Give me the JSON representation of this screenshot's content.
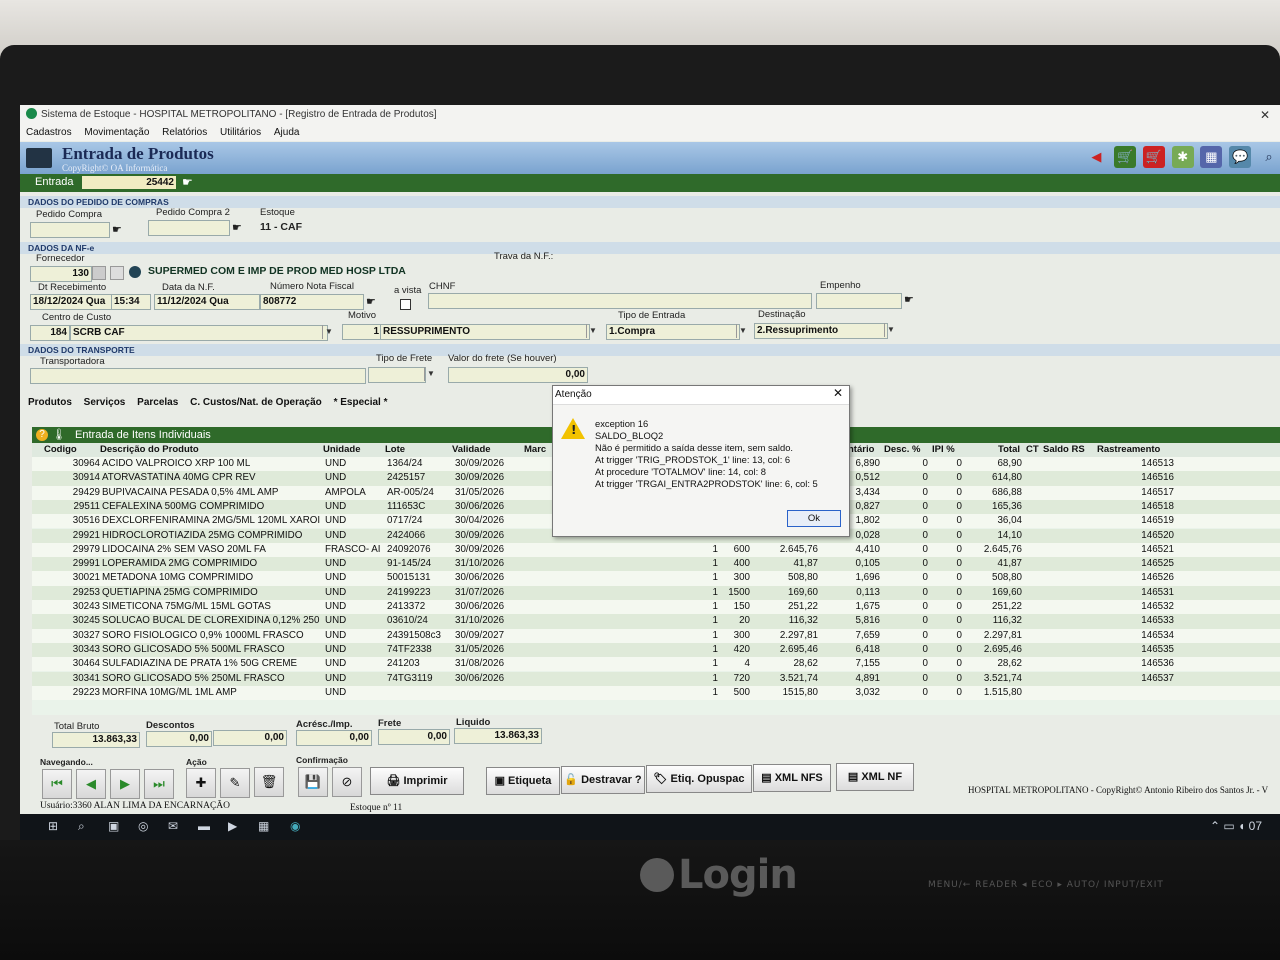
{
  "window": {
    "title": "Sistema de Estoque - HOSPITAL METROPOLITANO - [Registro de Entrada de Produtos]"
  },
  "menu": [
    "Cadastros",
    "Movimentação",
    "Relatórios",
    "Utilitários",
    "Ajuda"
  ],
  "header": {
    "title": "Entrada de Produtos",
    "copyright": "CopyRight© OA Informática"
  },
  "entrada": {
    "label": "Entrada",
    "value": "25442"
  },
  "pedido": {
    "section": "DADOS DO PEDIDO DE COMPRAS",
    "pedido_compra_label": "Pedido Compra",
    "pedido_compra2_label": "Pedido Compra 2",
    "estoque_label": "Estoque",
    "estoque_value": "11 - CAF"
  },
  "nfe": {
    "section": "DADOS DA NF-e",
    "fornecedor_label": "Fornecedor",
    "fornecedor_code": "130",
    "fornecedor_name": "SUPERMED COM E IMP DE PROD MED HOSP LTDA",
    "trava_label": "Trava da N.F.:",
    "dt_receb_label": "Dt Recebimento",
    "dt_receb_date": "18/12/2024 Qua",
    "dt_receb_time": "15:34",
    "data_nf_label": "Data da N.F.",
    "data_nf_value": "11/12/2024 Qua",
    "numero_label": "Número Nota Fiscal",
    "numero_value": "808772",
    "avista_label": "a vista",
    "chnf_label": "CHNF",
    "empenho_label": "Empenho",
    "cc_label": "Centro de Custo",
    "cc_code": "184",
    "cc_name": "SCRB CAF",
    "motivo_label": "Motivo",
    "motivo_code": "1",
    "motivo_name": "RESSUPRIMENTO",
    "tipo_label": "Tipo de Entrada",
    "tipo_value": "1.Compra",
    "dest_label": "Destinação",
    "dest_value": "2.Ressuprimento"
  },
  "transporte": {
    "section": "DADOS DO TRANSPORTE",
    "transportadora_label": "Transportadora",
    "frete_label": "Tipo de Frete",
    "valor_label": "Valor do frete (Se houver)",
    "valor_value": "0,00"
  },
  "tabs": [
    "Produtos",
    "Serviços",
    "Parcelas",
    "C. Custos/Nat. de Operação",
    "* Especial *"
  ],
  "grid": {
    "title": "Entrada de Itens Individuais",
    "headers": [
      "Codigo",
      "Descrição do Produto",
      "Unidade",
      "Lote",
      "Validade",
      "Marc",
      "ntário",
      "Desc. %",
      "IPI %",
      "Total",
      "CT",
      "Saldo RS",
      "Rastreamento"
    ],
    "rows": [
      {
        "cod": "30964",
        "desc": "ACIDO VALPROICO XRP 100 ML",
        "un": "UND",
        "lote": "1364/24",
        "val": "30/09/2026",
        "qt": "",
        "qty": "",
        "unit": "6,890",
        "d": "0",
        "i": "0",
        "tot": "68,90",
        "r": "146513"
      },
      {
        "cod": "30914",
        "desc": "ATORVASTATINA 40MG CPR REV",
        "un": "UND",
        "lote": "2425157",
        "val": "30/09/2026",
        "qt": "",
        "qty": "",
        "unit": "0,512",
        "d": "0",
        "i": "0",
        "tot": "614,80",
        "r": "146516"
      },
      {
        "cod": "29429",
        "desc": "BUPIVACAINA PESADA 0,5% 4ML AMP",
        "un": "AMPOLA",
        "lote": "AR-005/24",
        "val": "31/05/2026",
        "qt": "",
        "qty": "",
        "unit": "3,434",
        "d": "0",
        "i": "0",
        "tot": "686,88",
        "r": "146517"
      },
      {
        "cod": "29511",
        "desc": "CEFALEXINA 500MG COMPRIMIDO",
        "un": "UND",
        "lote": "111653C",
        "val": "30/06/2026",
        "qt": "",
        "qty": "",
        "unit": "0,827",
        "d": "0",
        "i": "0",
        "tot": "165,36",
        "r": "146518"
      },
      {
        "cod": "30516",
        "desc": "DEXCLORFENIRAMINA 2MG/5ML 120ML XAROI",
        "un": "UND",
        "lote": "0717/24",
        "val": "30/04/2026",
        "qt": "",
        "qty": "",
        "unit": "1,802",
        "d": "0",
        "i": "0",
        "tot": "36,04",
        "r": "146519"
      },
      {
        "cod": "29921",
        "desc": "HIDROCLOROTIAZIDA 25MG COMPRIMIDO",
        "un": "UND",
        "lote": "2424066",
        "val": "30/09/2026",
        "qt": "",
        "qty": "",
        "unit": "0,028",
        "d": "0",
        "i": "0",
        "tot": "14,10",
        "r": "146520"
      },
      {
        "cod": "29979",
        "desc": "LIDOCAINA 2% SEM VASO 20ML FA",
        "un": "FRASCO- AI",
        "lote": "24092076",
        "val": "30/09/2026",
        "qt": "1",
        "qty": "600",
        "sub": "2.645,76",
        "unit": "4,410",
        "d": "0",
        "i": "0",
        "tot": "2.645,76",
        "r": "146521"
      },
      {
        "cod": "29991",
        "desc": "LOPERAMIDA 2MG COMPRIMIDO",
        "un": "UND",
        "lote": "91-145/24",
        "val": "31/10/2026",
        "qt": "1",
        "qty": "400",
        "sub": "41,87",
        "unit": "0,105",
        "d": "0",
        "i": "0",
        "tot": "41,87",
        "r": "146525"
      },
      {
        "cod": "30021",
        "desc": "METADONA 10MG COMPRIMIDO",
        "un": "UND",
        "lote": "50015131",
        "val": "30/06/2026",
        "qt": "1",
        "qty": "300",
        "sub": "508,80",
        "unit": "1,696",
        "d": "0",
        "i": "0",
        "tot": "508,80",
        "r": "146526"
      },
      {
        "cod": "29253",
        "desc": "QUETIAPINA 25MG COMPRIMIDO",
        "un": "UND",
        "lote": "24199223",
        "val": "31/07/2026",
        "qt": "1",
        "qty": "1500",
        "sub": "169,60",
        "unit": "0,113",
        "d": "0",
        "i": "0",
        "tot": "169,60",
        "r": "146531"
      },
      {
        "cod": "30243",
        "desc": "SIMETICONA 75MG/ML 15ML GOTAS",
        "un": "UND",
        "lote": "2413372",
        "val": "30/06/2026",
        "qt": "1",
        "qty": "150",
        "sub": "251,22",
        "unit": "1,675",
        "d": "0",
        "i": "0",
        "tot": "251,22",
        "r": "146532"
      },
      {
        "cod": "30245",
        "desc": "SOLUCAO BUCAL DE CLOREXIDINA 0,12% 250",
        "un": "UND",
        "lote": "03610/24",
        "val": "31/10/2026",
        "qt": "1",
        "qty": "20",
        "sub": "116,32",
        "unit": "5,816",
        "d": "0",
        "i": "0",
        "tot": "116,32",
        "r": "146533"
      },
      {
        "cod": "30327",
        "desc": "SORO FISIOLOGICO 0,9% 1000ML FRASCO",
        "un": "UND",
        "lote": "24391508c3",
        "val": "30/09/2027",
        "qt": "1",
        "qty": "300",
        "sub": "2.297,81",
        "unit": "7,659",
        "d": "0",
        "i": "0",
        "tot": "2.297,81",
        "r": "146534"
      },
      {
        "cod": "30343",
        "desc": "SORO GLICOSADO 5% 500ML FRASCO",
        "un": "UND",
        "lote": "74TF2338",
        "val": "31/05/2026",
        "qt": "1",
        "qty": "420",
        "sub": "2.695,46",
        "unit": "6,418",
        "d": "0",
        "i": "0",
        "tot": "2.695,46",
        "r": "146535"
      },
      {
        "cod": "30464",
        "desc": "SULFADIAZINA DE PRATA 1% 50G CREME",
        "un": "UND",
        "lote": "241203",
        "val": "31/08/2026",
        "qt": "1",
        "qty": "4",
        "sub": "28,62",
        "unit": "7,155",
        "d": "0",
        "i": "0",
        "tot": "28,62",
        "r": "146536"
      },
      {
        "cod": "30341",
        "desc": "SORO GLICOSADO 5% 250ML FRASCO",
        "un": "UND",
        "lote": "74TG3119",
        "val": "30/06/2026",
        "qt": "1",
        "qty": "720",
        "sub": "3.521,74",
        "unit": "4,891",
        "d": "0",
        "i": "0",
        "tot": "3.521,74",
        "r": "146537"
      },
      {
        "cod": "29223",
        "desc": "MORFINA 10MG/ML 1ML AMP",
        "un": "UND",
        "lote": "",
        "val": "",
        "qt": "1",
        "qty": "500",
        "sub": "1515,80",
        "unit": "3,032",
        "d": "0",
        "i": "0",
        "tot": "1.515,80",
        "r": ""
      }
    ]
  },
  "dialog": {
    "title": "Atenção",
    "lines": [
      "exception 16",
      "SALDO_BLOQ2",
      "Não é permitido a saída desse item, sem saldo.",
      "At trigger 'TRIG_PRODSTOK_1' line: 13, col: 6",
      "At procedure 'TOTALMOV' line: 14, col: 8",
      "At trigger 'TRGAI_ENTRA2PRODSTOK' line: 6, col: 5"
    ],
    "ok": "Ok"
  },
  "totals": {
    "bruto_label": "Total Bruto",
    "bruto": "13.863,33",
    "descontos_label": "Descontos",
    "desc1": "0,00",
    "desc2": "0,00",
    "acresc_label": "Acrésc./Imp.",
    "acresc": "0,00",
    "frete_label": "Frete",
    "frete": "0,00",
    "liquido_label": "Liquido",
    "liquido": "13.863,33"
  },
  "footer": {
    "nav_label": "Navegando...",
    "acao_label": "Ação",
    "conf_label": "Confirmação",
    "imprimir": "Imprimir",
    "etiqueta": "Etiqueta",
    "destravar": "Destravar ?",
    "etiq_opuspac": "Etiq. Opuspac",
    "xml_nfs": "XML NFS",
    "xml_nf": "XML NF"
  },
  "status": {
    "user": "Usuário:3360 ALAN LIMA DA ENCARNAÇÃO",
    "estoque": "Estoque nº 11",
    "company": "HOSPITAL METROPOLITANO - CopyRight© Antonio Ribeiro dos Santos Jr. - V"
  },
  "monitor": {
    "brand": "Login",
    "buttons": "MENU/← READER ◂ ECO ▸ AUTO/ INPUT/EXIT"
  }
}
